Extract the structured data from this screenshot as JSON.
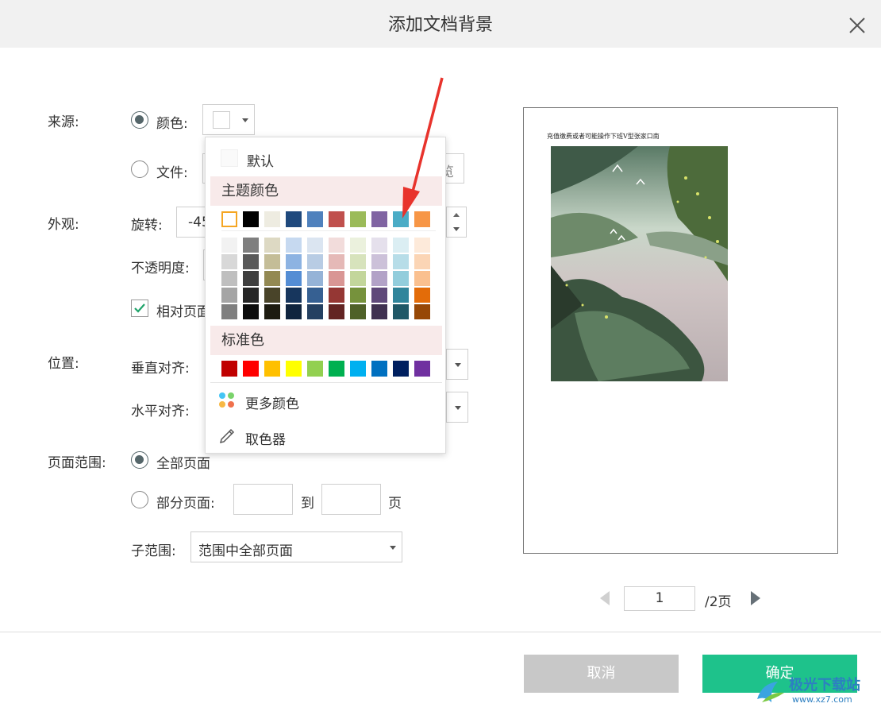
{
  "dialog": {
    "title": "添加文档背景"
  },
  "source": {
    "label": "来源:",
    "color_option": "颜色:",
    "file_option": "文件:",
    "browse_partial": "览"
  },
  "appearance": {
    "label": "外观:",
    "rotate_label": "旋转:",
    "rotate_value": "-45",
    "opacity_label": "不透明度:",
    "relative_label": "相对页面"
  },
  "position": {
    "label": "位置:",
    "vertical_label": "垂直对齐:",
    "horizontal_label": "水平对齐:"
  },
  "page_range": {
    "label": "页面范围:",
    "all_pages": "全部页面",
    "partial_pages": "部分页面:",
    "to_label": "到",
    "page_unit": "页",
    "subrange_label": "子范围:",
    "subrange_value": "范围中全部页面"
  },
  "color_popup": {
    "default_label": "默认",
    "theme_label": "主题颜色",
    "standard_label": "标准色",
    "more_colors": "更多颜色",
    "picker": "取色器",
    "theme_colors": [
      "#ffffff",
      "#000000",
      "#eeece1",
      "#1f497d",
      "#4f81bd",
      "#c0504d",
      "#9bbb59",
      "#8064a2",
      "#4bacc6",
      "#f79646"
    ],
    "tints": [
      [
        "#f2f2f2",
        "#7f7f7f",
        "#ddd9c3",
        "#c6d9f0",
        "#dbe5f1",
        "#f2dcdb",
        "#ebf1dd",
        "#e5e0ec",
        "#dbeef3",
        "#fdeada"
      ],
      [
        "#d8d8d8",
        "#595959",
        "#c4bd97",
        "#8db3e2",
        "#b8cce4",
        "#e5b9b7",
        "#d7e3bc",
        "#ccc1d9",
        "#b7dde8",
        "#fbd5b5"
      ],
      [
        "#bfbfbf",
        "#3f3f3f",
        "#938953",
        "#548dd4",
        "#95b3d7",
        "#d99694",
        "#c3d69b",
        "#b2a2c7",
        "#92cddc",
        "#fac08f"
      ],
      [
        "#a5a5a5",
        "#262626",
        "#494429",
        "#17365d",
        "#366092",
        "#953734",
        "#76923c",
        "#5f497a",
        "#31859b",
        "#e36c09"
      ],
      [
        "#7f7f7f",
        "#0c0c0c",
        "#1d1b10",
        "#0f243e",
        "#244061",
        "#632423",
        "#4f6128",
        "#3f3151",
        "#205867",
        "#974806"
      ]
    ],
    "standard_colors": [
      "#c00000",
      "#ff0000",
      "#ffc000",
      "#ffff00",
      "#92d050",
      "#00b050",
      "#00b0f0",
      "#0070c0",
      "#002060",
      "#7030a0"
    ]
  },
  "preview": {
    "page_text": "充值缴费或者可能操作下班V型张家口南",
    "current_page": "1",
    "total_pages": "/2页"
  },
  "footer": {
    "cancel": "取消",
    "ok": "确定"
  },
  "watermark": {
    "brand": "极光下载站",
    "url": "www.xz7.com"
  },
  "colors": {
    "ok_green": "#1ec28b",
    "cancel_gray": "#c8c8c8",
    "accent_arrow": "#e8332c"
  }
}
